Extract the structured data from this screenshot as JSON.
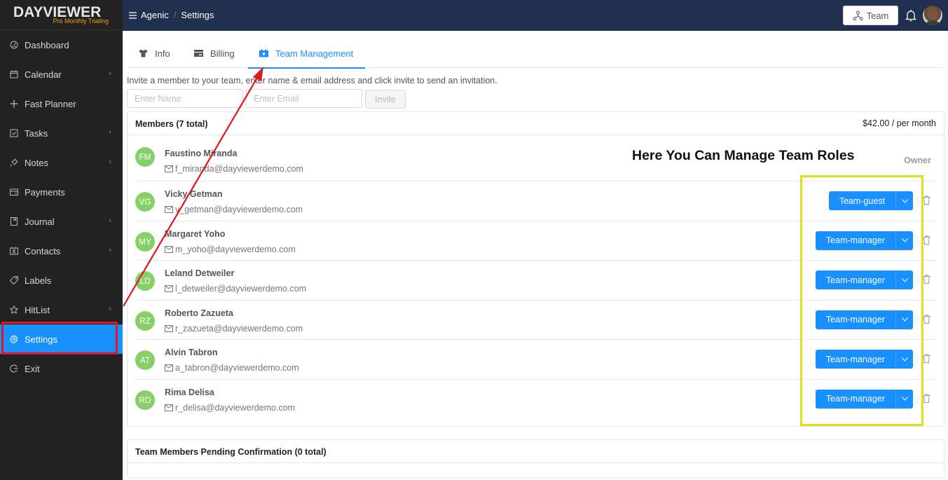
{
  "app": {
    "logo": "DAYVIEWER",
    "plan": "Pro Monthly Trialing"
  },
  "sidebar": {
    "items": [
      {
        "label": "Dashboard",
        "icon": "dashboard-icon",
        "has_children": false
      },
      {
        "label": "Calendar",
        "icon": "calendar-icon",
        "has_children": true
      },
      {
        "label": "Fast Planner",
        "icon": "plus-move-icon",
        "has_children": false
      },
      {
        "label": "Tasks",
        "icon": "checkbox-icon",
        "has_children": true
      },
      {
        "label": "Notes",
        "icon": "pushpin-icon",
        "has_children": true
      },
      {
        "label": "Payments",
        "icon": "credit-card-icon",
        "has_children": false
      },
      {
        "label": "Journal",
        "icon": "book-icon",
        "has_children": true
      },
      {
        "label": "Contacts",
        "icon": "contacts-icon",
        "has_children": true
      },
      {
        "label": "Labels",
        "icon": "tags-icon",
        "has_children": false
      },
      {
        "label": "HitList",
        "icon": "star-icon",
        "has_children": true
      },
      {
        "label": "Settings",
        "icon": "gear-icon",
        "has_children": false,
        "active": true
      },
      {
        "label": "Exit",
        "icon": "logout-icon",
        "has_children": false
      }
    ]
  },
  "header": {
    "breadcrumb": [
      "Agenic",
      "Settings"
    ],
    "separator": "/",
    "team_button": "Team"
  },
  "tabs": [
    {
      "label": "Info",
      "icon": "shirt-icon"
    },
    {
      "label": "Billing",
      "icon": "credit-card-icon"
    },
    {
      "label": "Team Management",
      "icon": "contacts-icon",
      "active": true
    }
  ],
  "invite": {
    "instructions": "Invite a member to your team, enter name & email address and click invite to send an invitation.",
    "name_placeholder": "Enter Name",
    "email_placeholder": "Enter Email",
    "name_value": "",
    "email_value": "",
    "button": "Invite"
  },
  "members": {
    "title": "Members (7 total)",
    "price": "$42.00 / per month",
    "owner_label": "Owner",
    "list": [
      {
        "initials": "FM",
        "name": "Faustino Miranda",
        "email": "f_miranda@dayviewerdemo.com",
        "role": "Owner"
      },
      {
        "initials": "VG",
        "name": "Vicky Getman",
        "email": "v_getman@dayviewerdemo.com",
        "role": "Team-guest"
      },
      {
        "initials": "MY",
        "name": "Margaret Yoho",
        "email": "m_yoho@dayviewerdemo.com",
        "role": "Team-manager"
      },
      {
        "initials": "LD",
        "name": "Leland Detweiler",
        "email": "l_detweiler@dayviewerdemo.com",
        "role": "Team-manager"
      },
      {
        "initials": "RZ",
        "name": "Roberto Zazueta",
        "email": "r_zazueta@dayviewerdemo.com",
        "role": "Team-manager"
      },
      {
        "initials": "AT",
        "name": "Alvin Tabron",
        "email": "a_tabron@dayviewerdemo.com",
        "role": "Team-manager"
      },
      {
        "initials": "RD",
        "name": "Rima Delisa",
        "email": "r_delisa@dayviewerdemo.com",
        "role": "Team-manager"
      }
    ]
  },
  "pending": {
    "title": "Team Members Pending Confirmation (0 total)"
  },
  "annotation": {
    "text": "Here You Can Manage Team Roles",
    "highlight_color": "#e0e01a",
    "arrow_color": "#e0161b"
  },
  "colors": {
    "primary": "#1890ff",
    "sidebar_bg": "#222222",
    "header_bg": "#223050",
    "avatar_bg": "#87d068",
    "logo_accent": "#e8a317"
  }
}
